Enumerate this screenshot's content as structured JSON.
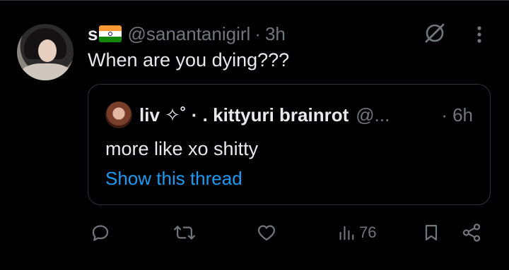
{
  "tweet": {
    "display_name": "s",
    "handle": "@sanantanigirl",
    "separator": "·",
    "time": "3h",
    "text": "When are you dying???",
    "avatar_icon": "user-avatar",
    "flag_icon": "india-flag-emoji"
  },
  "quote": {
    "display_name": "liv ✧˚ · . kittyuri brainrot",
    "handle": "@...",
    "time": "· 6h",
    "text": "more like xo shitty",
    "show_thread": "Show this thread"
  },
  "actions": {
    "views_count": "76"
  },
  "colors": {
    "background": "#000000",
    "text": "#e7e9ea",
    "muted": "#71767b",
    "link": "#1d9bf0",
    "border": "#2f3336"
  }
}
